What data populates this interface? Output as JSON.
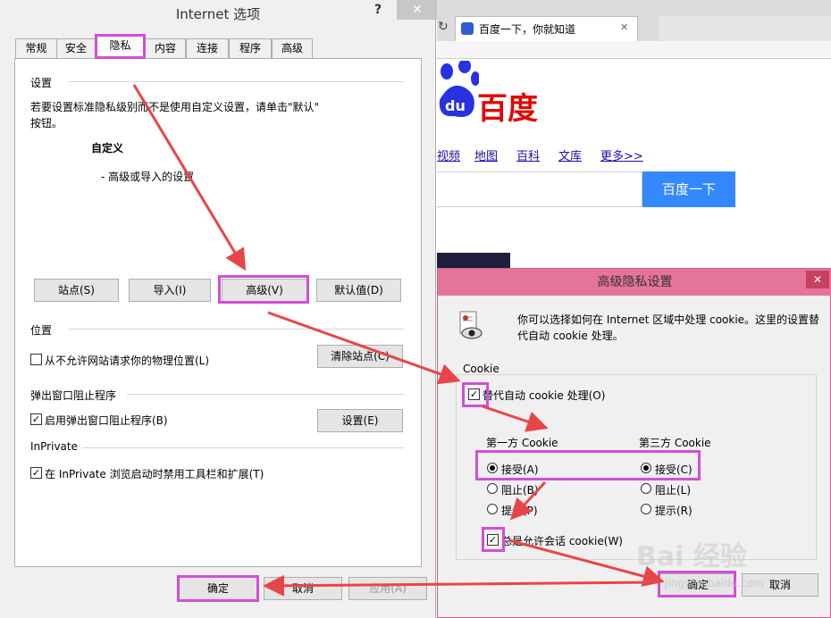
{
  "left_dialog": {
    "title": "Internet 选项",
    "help_label": "?",
    "close_label": "✕",
    "tabs": [
      {
        "label": "常规"
      },
      {
        "label": "安全"
      },
      {
        "label": "隐私"
      },
      {
        "label": "内容"
      },
      {
        "label": "连接"
      },
      {
        "label": "程序"
      },
      {
        "label": "高级"
      }
    ],
    "settings": {
      "heading": "设置",
      "description_line1": "若要设置标准隐私级别而不是使用自定义设置，请单击\"默认\"",
      "description_line2": "按钮。",
      "level_title": "自定义",
      "level_detail": "- 高级或导入的设置",
      "buttons": {
        "sites": "站点(S)",
        "import": "导入(I)",
        "advanced": "高级(V)",
        "default": "默认值(D)"
      }
    },
    "location": {
      "heading": "位置",
      "checkbox_label": "从不允许网站请求你的物理位置(L)",
      "clear_button": "清除站点(C)"
    },
    "popup": {
      "heading": "弹出窗口阻止程序",
      "checkbox_label": "启用弹出窗口阻止程序(B)",
      "settings_button": "设置(E)"
    },
    "inprivate": {
      "heading": "InPrivate",
      "checkbox_label": "在 InPrivate 浏览启动时禁用工具栏和扩展(T)"
    },
    "footer": {
      "ok": "确定",
      "cancel": "取消",
      "apply": "应用(A)"
    }
  },
  "browser": {
    "tab_title": "百度一下，你就知道",
    "tab_close": "✕",
    "refresh_icon": "↻",
    "logo_text": "百度",
    "nav_links": [
      "视频",
      "地图",
      "百科",
      "文库",
      "更多>>"
    ],
    "search_button": "百度一下"
  },
  "right_dialog": {
    "title": "高级隐私设置",
    "close_label": "✕",
    "intro_line1": "你可以选择如何在 Internet 区域中处理 cookie。这里的设置替",
    "intro_line2": "代自动 cookie 处理。",
    "group_label": "Cookie",
    "override_label": "替代自动 cookie 处理(O)",
    "first_party": {
      "heading": "第一方 Cookie",
      "options": [
        "接受(A)",
        "阻止(B)",
        "提示(P)"
      ],
      "selected": "接受(A)"
    },
    "third_party": {
      "heading": "第三方 Cookie",
      "options": [
        "接受(C)",
        "阻止(L)",
        "提示(R)"
      ],
      "selected": "接受(C)"
    },
    "session_label": "总是允许会话 cookie(W)",
    "ok": "确定",
    "cancel": "取消"
  },
  "watermark": {
    "main": "Bai 经验",
    "sub": "jingyan.baidu.com"
  },
  "colors": {
    "highlight": "#d24ed6",
    "arrow": "#e8454a",
    "baidu_red": "#e10602",
    "baidu_blue": "#3388ff"
  }
}
